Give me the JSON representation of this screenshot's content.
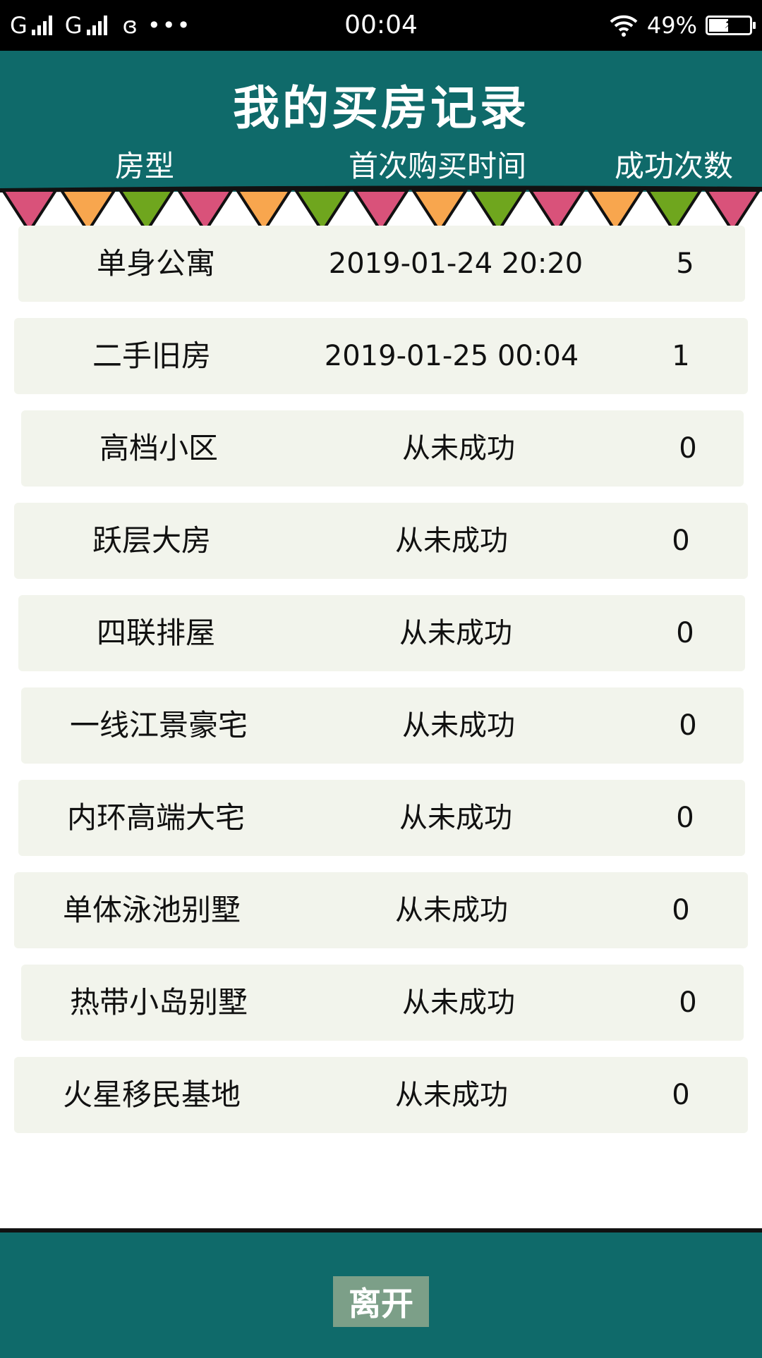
{
  "status_bar": {
    "carrier_1": "G",
    "carrier_2": "G",
    "swirl_icon": "ɞ",
    "dots_icon": "•••",
    "time": "00:04",
    "battery": "49%",
    "battery_level": 0.49,
    "icons": [
      "signal-icon",
      "signal-icon",
      "app-notification-icon",
      "more-icon",
      "wifi-icon",
      "battery-icon"
    ]
  },
  "header": {
    "title": "我的买房记录",
    "columns": [
      "房型",
      "首次购买时间",
      "成功次数"
    ]
  },
  "bunting_colors": [
    "#d9527a",
    "#f8a64e",
    "#6fa61e"
  ],
  "records": [
    {
      "type": "单身公寓",
      "first_time": "2019-01-24 20:20",
      "count": "5"
    },
    {
      "type": "二手旧房",
      "first_time": "2019-01-25 00:04",
      "count": "1"
    },
    {
      "type": "高档小区",
      "first_time": "从未成功",
      "count": "0"
    },
    {
      "type": "跃层大房",
      "first_time": "从未成功",
      "count": "0"
    },
    {
      "type": "四联排屋",
      "first_time": "从未成功",
      "count": "0"
    },
    {
      "type": "一线江景豪宅",
      "first_time": "从未成功",
      "count": "0"
    },
    {
      "type": "内环高端大宅",
      "first_time": "从未成功",
      "count": "0"
    },
    {
      "type": "单体泳池别墅",
      "first_time": "从未成功",
      "count": "0"
    },
    {
      "type": "热带小岛别墅",
      "first_time": "从未成功",
      "count": "0"
    },
    {
      "type": "火星移民基地",
      "first_time": "从未成功",
      "count": "0"
    }
  ],
  "footer": {
    "leave_label": "离开"
  },
  "colors": {
    "header_bg": "#0f6a6a",
    "row_bg": "#f2f4ec",
    "button_bg": "#7c9f88"
  }
}
